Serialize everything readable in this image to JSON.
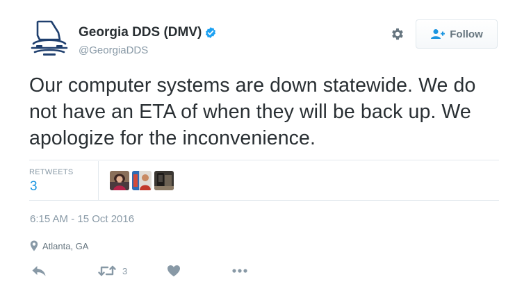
{
  "account": {
    "name": "Georgia DDS (DMV)",
    "handle": "@GeorgiaDDS",
    "verified": true,
    "avatar_icon": "georgia-dds-logo"
  },
  "header": {
    "follow_label": "Follow",
    "settings_icon": "gear-icon",
    "follow_icon": "follow-person-icon"
  },
  "tweet": {
    "text": "Our computer systems are down statewide. We do not have an ETA of when they will be back up. We apologize for the inconvenience."
  },
  "stats": {
    "retweets_label": "RETWEETS",
    "retweets_count": "3",
    "retweeter_avatars": [
      "retweeter-1",
      "retweeter-2",
      "retweeter-3"
    ]
  },
  "meta": {
    "timestamp": "6:15 AM - 15 Oct 2016",
    "location": "Atlanta, GA",
    "location_icon": "location-pin-icon"
  },
  "actions": {
    "reply_icon": "reply-icon",
    "retweet_icon": "retweet-icon",
    "retweet_count": "3",
    "like_icon": "heart-icon",
    "more_icon": "more-icon"
  },
  "colors": {
    "link_blue": "#1b95e0",
    "verified_blue": "#1da1f2",
    "muted_gray": "#8899a6",
    "text_dark": "#292f33",
    "logo_navy": "#1f3f6e"
  }
}
